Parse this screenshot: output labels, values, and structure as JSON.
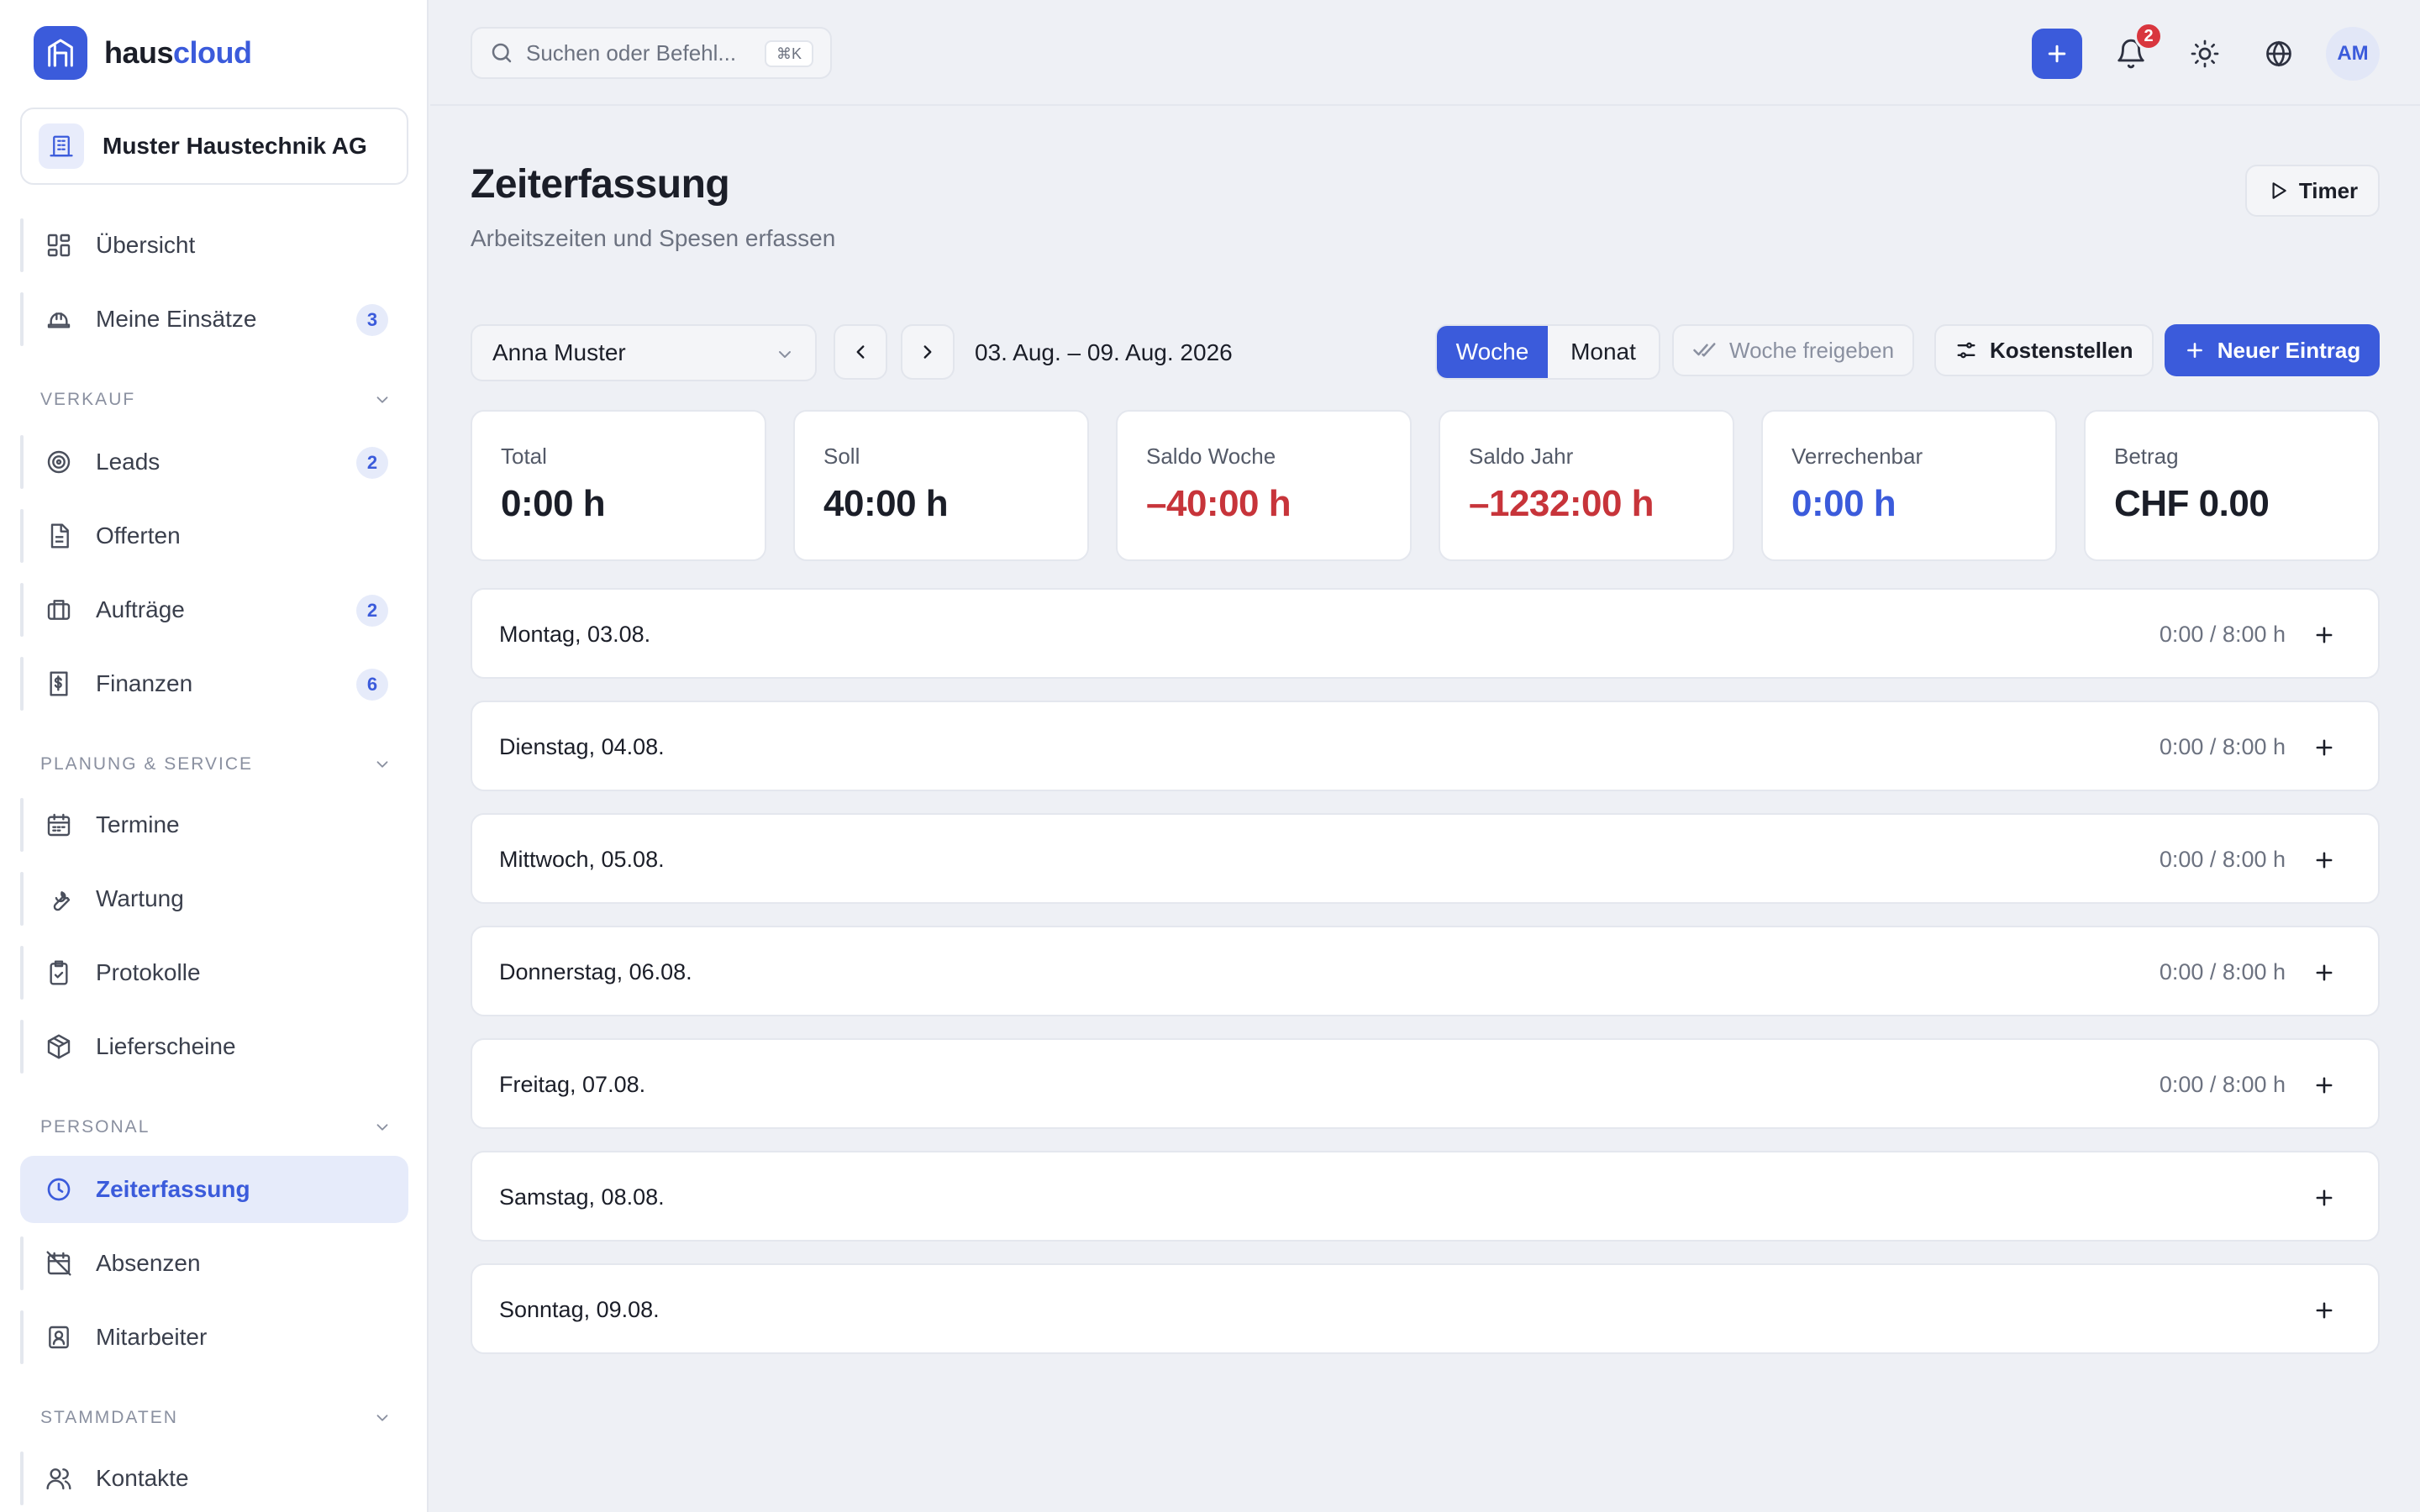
{
  "app": {
    "name_a": "haus",
    "name_b": "cloud"
  },
  "company": {
    "name": "Muster Haustechnik AG"
  },
  "sidebar": {
    "top_items": [
      {
        "label": "Übersicht",
        "icon": "dashboard-icon"
      },
      {
        "label": "Meine Einsätze",
        "icon": "helmet-icon",
        "badge": "3"
      }
    ],
    "sections": [
      {
        "title": "VERKAUF",
        "items": [
          {
            "label": "Leads",
            "icon": "target-icon",
            "badge": "2"
          },
          {
            "label": "Offerten",
            "icon": "document-icon"
          },
          {
            "label": "Aufträge",
            "icon": "briefcase-icon",
            "badge": "2"
          },
          {
            "label": "Finanzen",
            "icon": "invoice-icon",
            "badge": "6"
          }
        ]
      },
      {
        "title": "PLANUNG & SERVICE",
        "items": [
          {
            "label": "Termine",
            "icon": "calendar-icon"
          },
          {
            "label": "Wartung",
            "icon": "wrench-icon"
          },
          {
            "label": "Protokolle",
            "icon": "clipboard-check-icon"
          },
          {
            "label": "Lieferscheine",
            "icon": "package-icon"
          }
        ]
      },
      {
        "title": "PERSONAL",
        "items": [
          {
            "label": "Zeiterfassung",
            "icon": "clock-icon",
            "active": true
          },
          {
            "label": "Absenzen",
            "icon": "calendar-off-icon"
          },
          {
            "label": "Mitarbeiter",
            "icon": "id-badge-icon"
          }
        ]
      },
      {
        "title": "STAMMDATEN",
        "items": [
          {
            "label": "Kontakte",
            "icon": "users-icon"
          }
        ]
      }
    ]
  },
  "topbar": {
    "search_placeholder": "Suchen oder Befehl...",
    "shortcut": "⌘K",
    "notification_count": "2",
    "avatar_initials": "AM"
  },
  "page": {
    "title": "Zeiterfassung",
    "subtitle": "Arbeitszeiten und Spesen erfassen",
    "timer_label": "Timer"
  },
  "toolbar": {
    "employee": "Anna Muster",
    "date_range": "03. Aug. – 09. Aug. 2026",
    "view_week": "Woche",
    "view_month": "Monat",
    "active_view": "Woche",
    "approve_week": "Woche freigeben",
    "cost_centers": "Kostenstellen",
    "new_entry": "Neuer Eintrag"
  },
  "stats": [
    {
      "label": "Total",
      "value": "0:00 h"
    },
    {
      "label": "Soll",
      "value": "40:00 h"
    },
    {
      "label": "Saldo Woche",
      "value": "–40:00 h",
      "tone": "negative"
    },
    {
      "label": "Saldo Jahr",
      "value": "–1232:00 h",
      "tone": "negative"
    },
    {
      "label": "Verrechenbar",
      "value": "0:00 h",
      "tone": "accent"
    },
    {
      "label": "Betrag",
      "value": "CHF 0.00"
    }
  ],
  "days": [
    {
      "label": "Montag, 03.08.",
      "hours": "0:00 / 8:00 h"
    },
    {
      "label": "Dienstag, 04.08.",
      "hours": "0:00 / 8:00 h"
    },
    {
      "label": "Mittwoch, 05.08.",
      "hours": "0:00 / 8:00 h"
    },
    {
      "label": "Donnerstag, 06.08.",
      "hours": "0:00 / 8:00 h"
    },
    {
      "label": "Freitag, 07.08.",
      "hours": "0:00 / 8:00 h"
    },
    {
      "label": "Samstag, 08.08.",
      "hours": ""
    },
    {
      "label": "Sonntag, 09.08.",
      "hours": ""
    }
  ],
  "colors": {
    "accent": "#3b5bdb",
    "negative": "#c7343a",
    "badge_red": "#d9363e"
  }
}
